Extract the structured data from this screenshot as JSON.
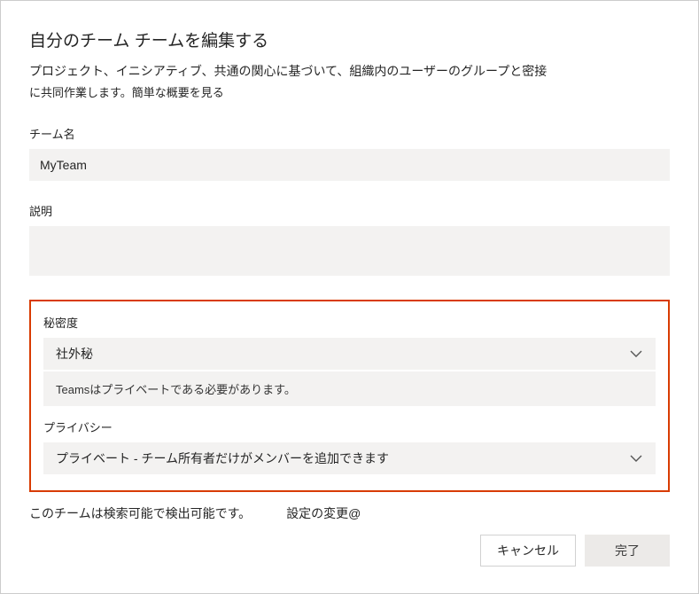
{
  "dialog": {
    "title": "自分のチーム チームを編集する",
    "subtitle_line1": "プロジェクト、イニシアティブ、共通の関心に基づいて、組織内のユーザーのグループと密接",
    "subtitle_line2": "に共同作業します。簡単な概要を見る"
  },
  "fields": {
    "team_name": {
      "label": "チーム名",
      "value": "MyTeam"
    },
    "description": {
      "label": "説明",
      "value": ""
    },
    "sensitivity": {
      "label": "秘密度",
      "selected": "社外秘",
      "helper": "Teamsはプライベートである必要があります。"
    },
    "privacy": {
      "label": "プライバシー",
      "selected": "プライベート - チーム所有者だけがメンバーを追加できます"
    }
  },
  "footer": {
    "searchable_text": "このチームは検索可能で検出可能です。",
    "change_settings": "設定の変更@"
  },
  "buttons": {
    "cancel": "キャンセル",
    "done": "完了"
  }
}
